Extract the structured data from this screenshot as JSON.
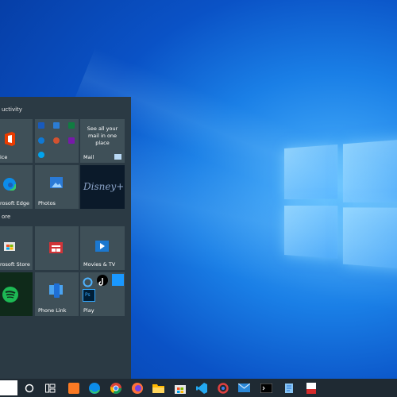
{
  "desktop": {
    "wallpaper": "windows-10-hero"
  },
  "start_menu": {
    "groups": [
      {
        "label": "uctivity"
      },
      {
        "label": "ore"
      }
    ],
    "tiles": {
      "office": "ice",
      "mail_promo": "See all your mail in one place",
      "mail": "Mail",
      "edge": "rosoft Edge",
      "photos": "Photos",
      "disney": "Disney+",
      "store": "rosoft Store",
      "news": "",
      "movies": "Movies & TV",
      "spotify": "",
      "phone_link": "Phone Link",
      "play": "Play"
    }
  },
  "taskbar": {
    "icons": [
      "search-box",
      "cortana-icon",
      "task-view-icon",
      "xampp-icon",
      "edge-icon",
      "chrome-icon",
      "firefox-icon",
      "file-explorer-icon",
      "store-icon",
      "vscode-icon",
      "app-icon",
      "mail-icon",
      "terminal-icon",
      "notepad-icon",
      "pdf-icon"
    ]
  },
  "colors": {
    "accent": "#0078d7",
    "start_bg": "#2b3a44",
    "tile_bg": "#3f5058",
    "taskbar_bg": "#1f2a33"
  }
}
